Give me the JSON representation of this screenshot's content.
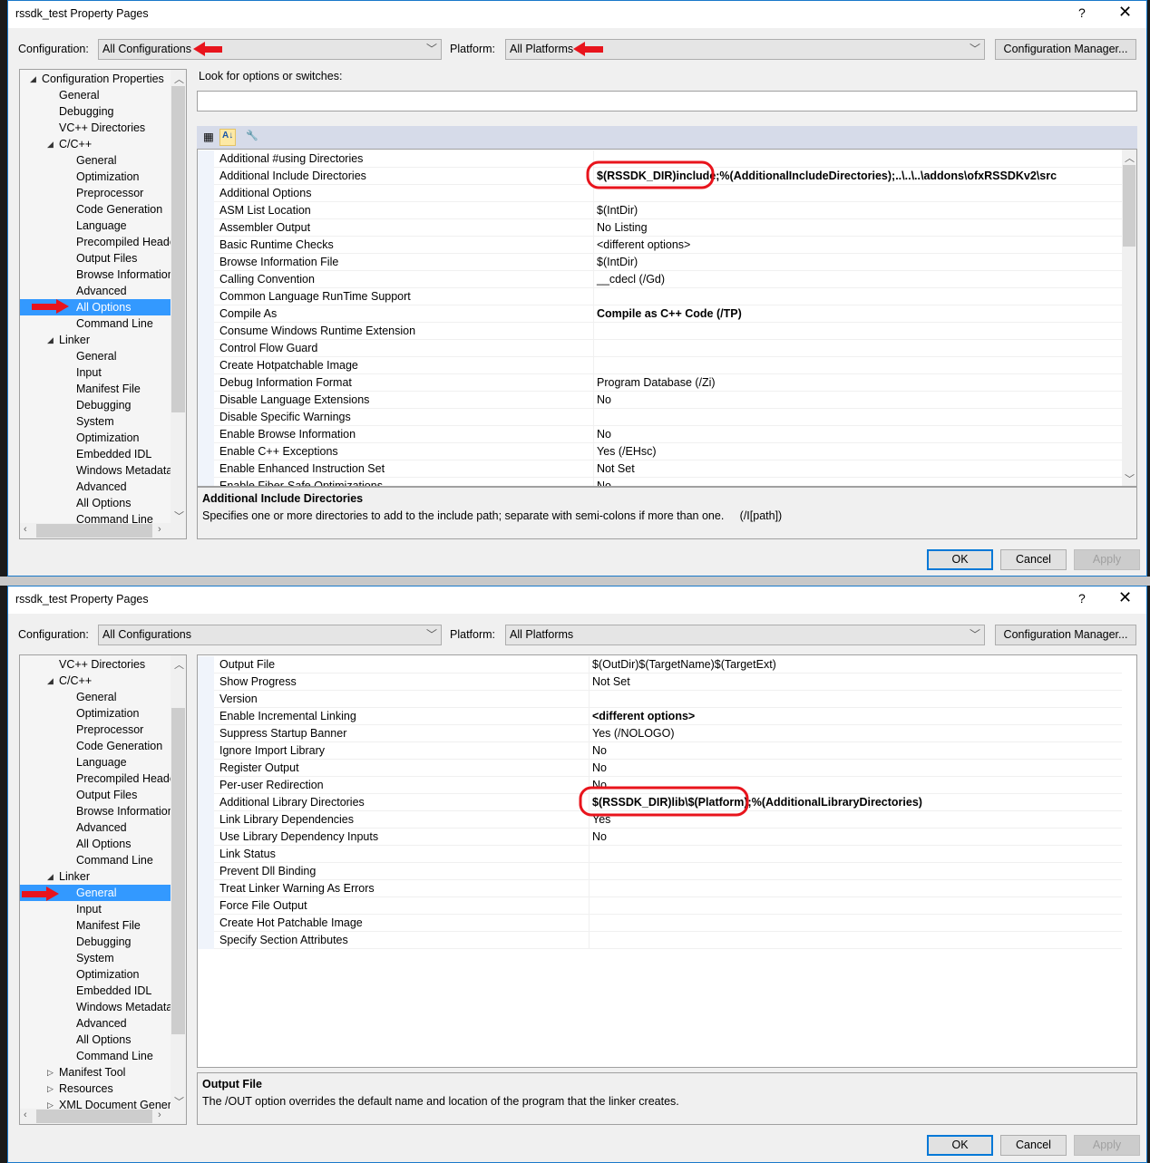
{
  "colors": {
    "selection": "#3399ff",
    "annotation": "#e8141c",
    "focus": "#0078d7"
  },
  "dialogs": [
    {
      "title": "rssdk_test Property Pages",
      "help": "?",
      "close": "✕",
      "config_label": "Configuration:",
      "config_value": "All Configurations",
      "platform_label": "Platform:",
      "platform_value": "All Platforms",
      "config_manager": "Configuration Manager...",
      "search_label": "Look for options or switches:",
      "search_value": "",
      "toolbar_icons": [
        "categorized-icon",
        "alphabetical-sort-icon",
        "property-pages-wrench-icon"
      ],
      "tree": [
        {
          "label": "Configuration Properties",
          "level": 0,
          "expander": "expanded"
        },
        {
          "label": "General",
          "level": 1
        },
        {
          "label": "Debugging",
          "level": 1
        },
        {
          "label": "VC++ Directories",
          "level": 1
        },
        {
          "label": "C/C++",
          "level": 1,
          "expander": "expanded"
        },
        {
          "label": "General",
          "level": 2
        },
        {
          "label": "Optimization",
          "level": 2
        },
        {
          "label": "Preprocessor",
          "level": 2
        },
        {
          "label": "Code Generation",
          "level": 2
        },
        {
          "label": "Language",
          "level": 2
        },
        {
          "label": "Precompiled Heade",
          "level": 2
        },
        {
          "label": "Output Files",
          "level": 2
        },
        {
          "label": "Browse Information",
          "level": 2
        },
        {
          "label": "Advanced",
          "level": 2
        },
        {
          "label": "All Options",
          "level": 2,
          "selected": true
        },
        {
          "label": "Command Line",
          "level": 2
        },
        {
          "label": "Linker",
          "level": 1,
          "expander": "expanded"
        },
        {
          "label": "General",
          "level": 2
        },
        {
          "label": "Input",
          "level": 2
        },
        {
          "label": "Manifest File",
          "level": 2
        },
        {
          "label": "Debugging",
          "level": 2
        },
        {
          "label": "System",
          "level": 2
        },
        {
          "label": "Optimization",
          "level": 2
        },
        {
          "label": "Embedded IDL",
          "level": 2
        },
        {
          "label": "Windows Metadata",
          "level": 2
        },
        {
          "label": "Advanced",
          "level": 2
        },
        {
          "label": "All Options",
          "level": 2
        },
        {
          "label": "Command Line",
          "level": 2
        }
      ],
      "properties": [
        {
          "name": "Additional #using Directories",
          "value": ""
        },
        {
          "name": "Additional Include Directories",
          "value": "$(RSSDK_DIR)include;%(AdditionalIncludeDirectories);..\\..\\..\\addons\\ofxRSSDKv2\\src",
          "bold": true
        },
        {
          "name": "Additional Options",
          "value": ""
        },
        {
          "name": "ASM List Location",
          "value": "$(IntDir)"
        },
        {
          "name": "Assembler Output",
          "value": "No Listing"
        },
        {
          "name": "Basic Runtime Checks",
          "value": "<different options>"
        },
        {
          "name": "Browse Information File",
          "value": "$(IntDir)"
        },
        {
          "name": "Calling Convention",
          "value": "__cdecl (/Gd)"
        },
        {
          "name": "Common Language RunTime Support",
          "value": ""
        },
        {
          "name": "Compile As",
          "value": "Compile as C++ Code (/TP)",
          "bold": true
        },
        {
          "name": "Consume Windows Runtime Extension",
          "value": ""
        },
        {
          "name": "Control Flow Guard",
          "value": ""
        },
        {
          "name": "Create Hotpatchable Image",
          "value": ""
        },
        {
          "name": "Debug Information Format",
          "value": "Program Database (/Zi)"
        },
        {
          "name": "Disable Language Extensions",
          "value": "No"
        },
        {
          "name": "Disable Specific Warnings",
          "value": ""
        },
        {
          "name": "Enable Browse Information",
          "value": "No"
        },
        {
          "name": "Enable C++ Exceptions",
          "value": "Yes (/EHsc)"
        },
        {
          "name": "Enable Enhanced Instruction Set",
          "value": "Not Set"
        },
        {
          "name": "Enable Fiber-Safe Optimizations",
          "value": "No"
        }
      ],
      "description": {
        "title": "Additional Include Directories",
        "text": "Specifies one or more directories to add to the include path; separate with semi-colons if more than one.     (/I[path])"
      },
      "buttons": {
        "ok": "OK",
        "cancel": "Cancel",
        "apply": "Apply"
      }
    },
    {
      "title": "rssdk_test Property Pages",
      "help": "?",
      "close": "✕",
      "config_label": "Configuration:",
      "config_value": "All Configurations",
      "platform_label": "Platform:",
      "platform_value": "All Platforms",
      "config_manager": "Configuration Manager...",
      "tree": [
        {
          "label": "VC++ Directories",
          "level": 1
        },
        {
          "label": "C/C++",
          "level": 1,
          "expander": "expanded"
        },
        {
          "label": "General",
          "level": 2
        },
        {
          "label": "Optimization",
          "level": 2
        },
        {
          "label": "Preprocessor",
          "level": 2
        },
        {
          "label": "Code Generation",
          "level": 2
        },
        {
          "label": "Language",
          "level": 2
        },
        {
          "label": "Precompiled Heade",
          "level": 2
        },
        {
          "label": "Output Files",
          "level": 2
        },
        {
          "label": "Browse Information",
          "level": 2
        },
        {
          "label": "Advanced",
          "level": 2
        },
        {
          "label": "All Options",
          "level": 2
        },
        {
          "label": "Command Line",
          "level": 2
        },
        {
          "label": "Linker",
          "level": 1,
          "expander": "expanded"
        },
        {
          "label": "General",
          "level": 2,
          "selected": true
        },
        {
          "label": "Input",
          "level": 2
        },
        {
          "label": "Manifest File",
          "level": 2
        },
        {
          "label": "Debugging",
          "level": 2
        },
        {
          "label": "System",
          "level": 2
        },
        {
          "label": "Optimization",
          "level": 2
        },
        {
          "label": "Embedded IDL",
          "level": 2
        },
        {
          "label": "Windows Metadata",
          "level": 2
        },
        {
          "label": "Advanced",
          "level": 2
        },
        {
          "label": "All Options",
          "level": 2
        },
        {
          "label": "Command Line",
          "level": 2
        },
        {
          "label": "Manifest Tool",
          "level": 1,
          "expander": "collapsed"
        },
        {
          "label": "Resources",
          "level": 1,
          "expander": "collapsed"
        },
        {
          "label": "XML Document Genera",
          "level": 1,
          "expander": "collapsed"
        }
      ],
      "properties": [
        {
          "name": "Output File",
          "value": "$(OutDir)$(TargetName)$(TargetExt)"
        },
        {
          "name": "Show Progress",
          "value": "Not Set"
        },
        {
          "name": "Version",
          "value": ""
        },
        {
          "name": "Enable Incremental Linking",
          "value": "<different options>",
          "bold": true
        },
        {
          "name": "Suppress Startup Banner",
          "value": "Yes (/NOLOGO)"
        },
        {
          "name": "Ignore Import Library",
          "value": "No"
        },
        {
          "name": "Register Output",
          "value": "No"
        },
        {
          "name": "Per-user Redirection",
          "value": "No"
        },
        {
          "name": "Additional Library Directories",
          "value": "$(RSSDK_DIR)lib\\$(Platform);%(AdditionalLibraryDirectories)",
          "bold": true
        },
        {
          "name": "Link Library Dependencies",
          "value": "Yes"
        },
        {
          "name": "Use Library Dependency Inputs",
          "value": "No"
        },
        {
          "name": "Link Status",
          "value": ""
        },
        {
          "name": "Prevent Dll Binding",
          "value": ""
        },
        {
          "name": "Treat Linker Warning As Errors",
          "value": ""
        },
        {
          "name": "Force File Output",
          "value": ""
        },
        {
          "name": "Create Hot Patchable Image",
          "value": ""
        },
        {
          "name": "Specify Section Attributes",
          "value": ""
        }
      ],
      "description": {
        "title": "Output File",
        "text": "The /OUT option overrides the default name and location of the program that the linker creates."
      },
      "buttons": {
        "ok": "OK",
        "cancel": "Cancel",
        "apply": "Apply"
      }
    }
  ]
}
